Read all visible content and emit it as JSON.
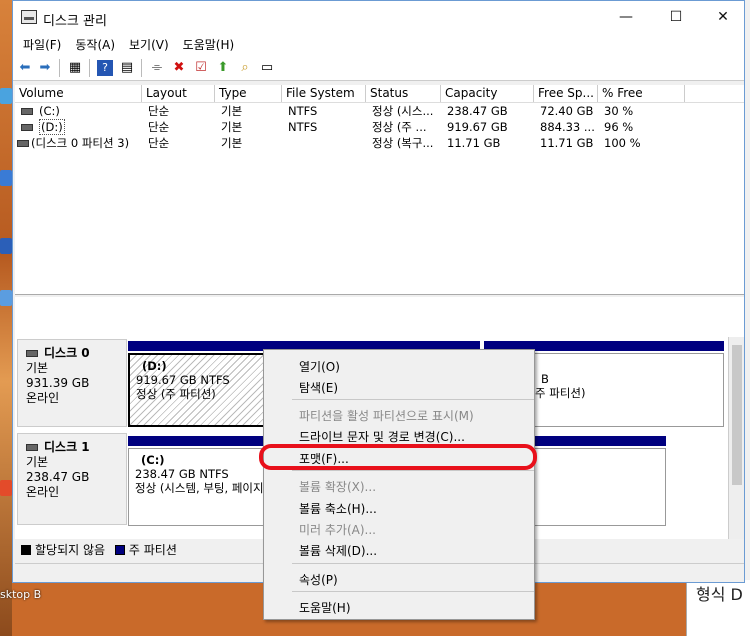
{
  "window": {
    "title": "디스크 관리",
    "controls": {
      "minimize": "—",
      "maximize": "☐",
      "close": "✕"
    }
  },
  "menu": [
    "파일(F)",
    "동작(A)",
    "보기(V)",
    "도움말(H)"
  ],
  "columns": [
    "Volume",
    "Layout",
    "Type",
    "File System",
    "Status",
    "Capacity",
    "Free Sp...",
    "% Free"
  ],
  "volumes": [
    {
      "volume": "(C:)",
      "layout": "단순",
      "type": "기본",
      "fs": "NTFS",
      "status": "정상 (시스...",
      "capacity": "238.47 GB",
      "free": "72.40 GB",
      "pct": "30 %"
    },
    {
      "volume": "(D:)",
      "layout": "단순",
      "type": "기본",
      "fs": "NTFS",
      "status": "정상 (주 ...",
      "capacity": "919.67 GB",
      "free": "884.33 ...",
      "pct": "96 %"
    },
    {
      "volume": "(디스크 0 파티션 3)",
      "layout": "단순",
      "type": "기본",
      "fs": "",
      "status": "정상 (복구...",
      "capacity": "11.71 GB",
      "free": "11.71 GB",
      "pct": "100 %"
    }
  ],
  "disks": [
    {
      "name": "디스크 0",
      "kind": "기본",
      "size": "931.39 GB",
      "state": "온라인",
      "partA": {
        "letter": "(D:)",
        "size": "919.67 GB NTFS",
        "status": "정상 (주 파티션)"
      },
      "partB": {
        "size": "B",
        "status": "주 파티션)"
      }
    },
    {
      "name": "디스크 1",
      "kind": "기본",
      "size": "238.47 GB",
      "state": "온라인",
      "partA": {
        "letter": "(C:)",
        "size": "238.47 GB NTFS",
        "status": "정상 (시스템, 부팅, 페이지"
      }
    }
  ],
  "legend": {
    "unallocated": "할당되지 않음",
    "primary": "주 파티션"
  },
  "context_menu": [
    {
      "label": "열기(O)",
      "enabled": true
    },
    {
      "label": "탐색(E)",
      "enabled": true
    },
    {
      "label": "파티션을 활성 파티션으로 표시(M)",
      "enabled": false
    },
    {
      "label": "드라이브 문자 및 경로 변경(C)...",
      "enabled": true
    },
    {
      "label": "포맷(F)...",
      "enabled": true
    },
    {
      "label": "볼륨 확장(X)...",
      "enabled": false
    },
    {
      "label": "볼륨 축소(H)...",
      "enabled": true
    },
    {
      "label": "미러 추가(A)...",
      "enabled": false
    },
    {
      "label": "볼륨 삭제(D)...",
      "enabled": true
    },
    {
      "label": "속성(P)",
      "enabled": true
    },
    {
      "label": "도움말(H)",
      "enabled": true
    }
  ],
  "desktop": {
    "label_bottom": "sktop B",
    "bg_window_text": "형식 D"
  },
  "colors": {
    "primary_partition": "#00007f",
    "highlight": "#e8101b"
  }
}
